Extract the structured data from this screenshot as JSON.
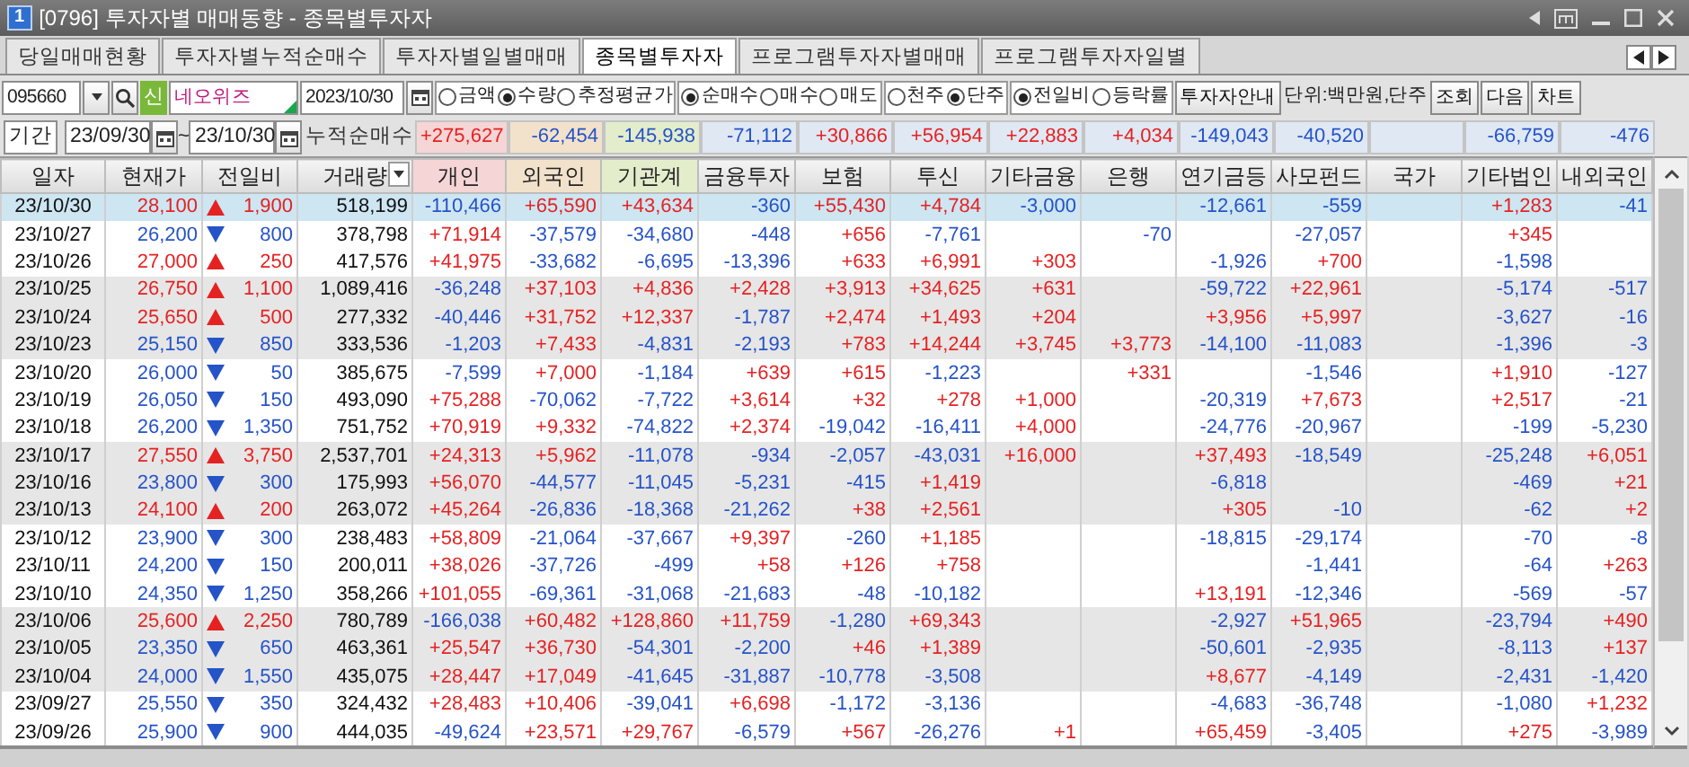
{
  "window": {
    "badge": "1",
    "title": "[0796] 투자자별 매매동향 - 종목별투자자"
  },
  "tabs": [
    {
      "label": "당일매매현황",
      "selected": false
    },
    {
      "label": "투자자별누적순매수",
      "selected": false
    },
    {
      "label": "투자자별일별매매",
      "selected": false
    },
    {
      "label": "종목별투자자",
      "selected": true
    },
    {
      "label": "프로그램투자자별매매",
      "selected": false
    },
    {
      "label": "프로그램투자자일별",
      "selected": false
    }
  ],
  "toolbar": {
    "stock_code": "095660",
    "market_badge": "신",
    "stock_name": "네오위즈",
    "date": "2023/10/30",
    "radio_groups": [
      [
        {
          "label": "금액",
          "selected": false
        },
        {
          "label": "수량",
          "selected": true
        },
        {
          "label": "추정평균가",
          "selected": false
        }
      ],
      [
        {
          "label": "순매수",
          "selected": true
        },
        {
          "label": "매수",
          "selected": false
        },
        {
          "label": "매도",
          "selected": false
        }
      ],
      [
        {
          "label": "천주",
          "selected": false
        },
        {
          "label": "단주",
          "selected": true
        }
      ],
      [
        {
          "label": "전일비",
          "selected": true
        },
        {
          "label": "등락률",
          "selected": false
        }
      ]
    ],
    "guide_button": "투자자안내",
    "unit": "단위:백만원,단주",
    "buttons": [
      "조회",
      "다음",
      "차트"
    ]
  },
  "period": {
    "label": "기간",
    "from": "23/09/30",
    "separator": "~",
    "to": "23/10/30",
    "summary_label": "누적순매수",
    "summary": {
      "column_5": "+275,627",
      "column_6": "-62,454",
      "column_7": "-145,938",
      "column_8": "-71,112",
      "column_9": "+30,866",
      "column_10": "+56,954",
      "column_11": "+22,883",
      "column_12": "+4,034",
      "column_13": "-149,043",
      "column_14": "-40,520",
      "column_16": "-66,759",
      "column_17": "-476"
    }
  },
  "table": {
    "columns": [
      {
        "label": "일자",
        "dropdown": false
      },
      {
        "label": "현재가",
        "dropdown": false
      },
      {
        "label": "전일비",
        "dropdown": false
      },
      {
        "label": "거래량",
        "dropdown": true
      },
      {
        "label": "개인",
        "dropdown": false,
        "color": "#f5d5d5"
      },
      {
        "label": "외국인",
        "dropdown": false,
        "color": "#f2e2cb"
      },
      {
        "label": "기관계",
        "dropdown": false,
        "color": "#e3edcc"
      },
      {
        "label": "금융투자",
        "dropdown": false
      },
      {
        "label": "보험",
        "dropdown": false
      },
      {
        "label": "투신",
        "dropdown": false
      },
      {
        "label": "기타금융",
        "dropdown": false
      },
      {
        "label": "은행",
        "dropdown": false
      },
      {
        "label": "연기금등",
        "dropdown": false
      },
      {
        "label": "사모펀드",
        "dropdown": false
      },
      {
        "label": "국가",
        "dropdown": false
      },
      {
        "label": "기타법인",
        "dropdown": false
      },
      {
        "label": "내외국인",
        "dropdown": false
      }
    ],
    "rows": [
      {
        "date": "23/10/30",
        "price": "28,100",
        "rising": true,
        "change": "1,900",
        "volume": "518,199",
        "selected": true,
        "shaded": false,
        "values": {
          "column_5": "-110,466",
          "column_6": "+65,590",
          "column_7": "+43,634",
          "column_8": "-360",
          "column_9": "+55,430",
          "column_10": "+4,784",
          "column_11": "-3,000",
          "column_13": "-12,661",
          "column_14": "-559",
          "column_16": "+1,283",
          "column_17": "-41"
        }
      },
      {
        "date": "23/10/27",
        "price": "26,200",
        "rising": false,
        "change": "800",
        "volume": "378,798",
        "selected": false,
        "shaded": false,
        "values": {
          "column_5": "+71,914",
          "column_6": "-37,579",
          "column_7": "-34,680",
          "column_8": "-448",
          "column_9": "+656",
          "column_10": "-7,761",
          "column_12": "-70",
          "column_14": "-27,057",
          "column_16": "+345"
        }
      },
      {
        "date": "23/10/26",
        "price": "27,000",
        "rising": true,
        "change": "250",
        "volume": "417,576",
        "selected": false,
        "shaded": false,
        "values": {
          "column_5": "+41,975",
          "column_6": "-33,682",
          "column_7": "-6,695",
          "column_8": "-13,396",
          "column_9": "+633",
          "column_10": "+6,991",
          "column_11": "+303",
          "column_13": "-1,926",
          "column_14": "+700",
          "column_16": "-1,598"
        }
      },
      {
        "date": "23/10/25",
        "price": "26,750",
        "rising": true,
        "change": "1,100",
        "volume": "1,089,416",
        "selected": false,
        "shaded": true,
        "values": {
          "column_5": "-36,248",
          "column_6": "+37,103",
          "column_7": "+4,836",
          "column_8": "+2,428",
          "column_9": "+3,913",
          "column_10": "+34,625",
          "column_11": "+631",
          "column_13": "-59,722",
          "column_14": "+22,961",
          "column_16": "-5,174",
          "column_17": "-517"
        }
      },
      {
        "date": "23/10/24",
        "price": "25,650",
        "rising": true,
        "change": "500",
        "volume": "277,332",
        "selected": false,
        "shaded": true,
        "values": {
          "column_5": "-40,446",
          "column_6": "+31,752",
          "column_7": "+12,337",
          "column_8": "-1,787",
          "column_9": "+2,474",
          "column_10": "+1,493",
          "column_11": "+204",
          "column_13": "+3,956",
          "column_14": "+5,997",
          "column_16": "-3,627",
          "column_17": "-16"
        }
      },
      {
        "date": "23/10/23",
        "price": "25,150",
        "rising": false,
        "change": "850",
        "volume": "333,536",
        "selected": false,
        "shaded": true,
        "values": {
          "column_5": "-1,203",
          "column_6": "+7,433",
          "column_7": "-4,831",
          "column_8": "-2,193",
          "column_9": "+783",
          "column_10": "+14,244",
          "column_11": "+3,745",
          "column_12": "+3,773",
          "column_13": "-14,100",
          "column_14": "-11,083",
          "column_16": "-1,396",
          "column_17": "-3"
        }
      },
      {
        "date": "23/10/20",
        "price": "26,000",
        "rising": false,
        "change": "50",
        "volume": "385,675",
        "selected": false,
        "shaded": false,
        "values": {
          "column_5": "-7,599",
          "column_6": "+7,000",
          "column_7": "-1,184",
          "column_8": "+639",
          "column_9": "+615",
          "column_10": "-1,223",
          "column_12": "+331",
          "column_14": "-1,546",
          "column_16": "+1,910",
          "column_17": "-127"
        }
      },
      {
        "date": "23/10/19",
        "price": "26,050",
        "rising": false,
        "change": "150",
        "volume": "493,090",
        "selected": false,
        "shaded": false,
        "values": {
          "column_5": "+75,288",
          "column_6": "-70,062",
          "column_7": "-7,722",
          "column_8": "+3,614",
          "column_9": "+32",
          "column_10": "+278",
          "column_11": "+1,000",
          "column_13": "-20,319",
          "column_14": "+7,673",
          "column_16": "+2,517",
          "column_17": "-21"
        }
      },
      {
        "date": "23/10/18",
        "price": "26,200",
        "rising": false,
        "change": "1,350",
        "volume": "751,752",
        "selected": false,
        "shaded": false,
        "values": {
          "column_5": "+70,919",
          "column_6": "+9,332",
          "column_7": "-74,822",
          "column_8": "+2,374",
          "column_9": "-19,042",
          "column_10": "-16,411",
          "column_11": "+4,000",
          "column_13": "-24,776",
          "column_14": "-20,967",
          "column_16": "-199",
          "column_17": "-5,230"
        }
      },
      {
        "date": "23/10/17",
        "price": "27,550",
        "rising": true,
        "change": "3,750",
        "volume": "2,537,701",
        "selected": false,
        "shaded": true,
        "values": {
          "column_5": "+24,313",
          "column_6": "+5,962",
          "column_7": "-11,078",
          "column_8": "-934",
          "column_9": "-2,057",
          "column_10": "-43,031",
          "column_11": "+16,000",
          "column_13": "+37,493",
          "column_14": "-18,549",
          "column_16": "-25,248",
          "column_17": "+6,051"
        }
      },
      {
        "date": "23/10/16",
        "price": "23,800",
        "rising": false,
        "change": "300",
        "volume": "175,993",
        "selected": false,
        "shaded": true,
        "values": {
          "column_5": "+56,070",
          "column_6": "-44,577",
          "column_7": "-11,045",
          "column_8": "-5,231",
          "column_9": "-415",
          "column_10": "+1,419",
          "column_13": "-6,818",
          "column_16": "-469",
          "column_17": "+21"
        }
      },
      {
        "date": "23/10/13",
        "price": "24,100",
        "rising": true,
        "change": "200",
        "volume": "263,072",
        "selected": false,
        "shaded": true,
        "values": {
          "column_5": "+45,264",
          "column_6": "-26,836",
          "column_7": "-18,368",
          "column_8": "-21,262",
          "column_9": "+38",
          "column_10": "+2,561",
          "column_13": "+305",
          "column_14": "-10",
          "column_16": "-62",
          "column_17": "+2"
        }
      },
      {
        "date": "23/10/12",
        "price": "23,900",
        "rising": false,
        "change": "300",
        "volume": "238,483",
        "selected": false,
        "shaded": false,
        "values": {
          "column_5": "+58,809",
          "column_6": "-21,064",
          "column_7": "-37,667",
          "column_8": "+9,397",
          "column_9": "-260",
          "column_10": "+1,185",
          "column_13": "-18,815",
          "column_14": "-29,174",
          "column_16": "-70",
          "column_17": "-8"
        }
      },
      {
        "date": "23/10/11",
        "price": "24,200",
        "rising": false,
        "change": "150",
        "volume": "200,011",
        "selected": false,
        "shaded": false,
        "values": {
          "column_5": "+38,026",
          "column_6": "-37,726",
          "column_7": "-499",
          "column_8": "+58",
          "column_9": "+126",
          "column_10": "+758",
          "column_14": "-1,441",
          "column_16": "-64",
          "column_17": "+263"
        }
      },
      {
        "date": "23/10/10",
        "price": "24,350",
        "rising": false,
        "change": "1,250",
        "volume": "358,266",
        "selected": false,
        "shaded": false,
        "values": {
          "column_5": "+101,055",
          "column_6": "-69,361",
          "column_7": "-31,068",
          "column_8": "-21,683",
          "column_9": "-48",
          "column_10": "-10,182",
          "column_13": "+13,191",
          "column_14": "-12,346",
          "column_16": "-569",
          "column_17": "-57"
        }
      },
      {
        "date": "23/10/06",
        "price": "25,600",
        "rising": true,
        "change": "2,250",
        "volume": "780,789",
        "selected": false,
        "shaded": true,
        "values": {
          "column_5": "-166,038",
          "column_6": "+60,482",
          "column_7": "+128,860",
          "column_8": "+11,759",
          "column_9": "-1,280",
          "column_10": "+69,343",
          "column_13": "-2,927",
          "column_14": "+51,965",
          "column_16": "-23,794",
          "column_17": "+490"
        }
      },
      {
        "date": "23/10/05",
        "price": "23,350",
        "rising": false,
        "change": "650",
        "volume": "463,361",
        "selected": false,
        "shaded": true,
        "values": {
          "column_5": "+25,547",
          "column_6": "+36,730",
          "column_7": "-54,301",
          "column_8": "-2,200",
          "column_9": "+46",
          "column_10": "+1,389",
          "column_13": "-50,601",
          "column_14": "-2,935",
          "column_16": "-8,113",
          "column_17": "+137"
        }
      },
      {
        "date": "23/10/04",
        "price": "24,000",
        "rising": false,
        "change": "1,550",
        "volume": "435,075",
        "selected": false,
        "shaded": true,
        "values": {
          "column_5": "+28,447",
          "column_6": "+17,049",
          "column_7": "-41,645",
          "column_8": "-31,887",
          "column_9": "-10,778",
          "column_10": "-3,508",
          "column_13": "+8,677",
          "column_14": "-4,149",
          "column_16": "-2,431",
          "column_17": "-1,420"
        }
      },
      {
        "date": "23/09/27",
        "price": "25,550",
        "rising": false,
        "change": "350",
        "volume": "324,432",
        "selected": false,
        "shaded": false,
        "values": {
          "column_5": "+28,483",
          "column_6": "+10,406",
          "column_7": "-39,041",
          "column_8": "+6,698",
          "column_9": "-1,172",
          "column_10": "-3,136",
          "column_13": "-4,683",
          "column_14": "-36,748",
          "column_16": "-1,080",
          "column_17": "+1,232"
        }
      },
      {
        "date": "23/09/26",
        "price": "25,900",
        "rising": false,
        "change": "900",
        "volume": "444,035",
        "selected": false,
        "shaded": false,
        "values": {
          "column_5": "-49,624",
          "column_6": "+23,571",
          "column_7": "+29,767",
          "column_8": "-6,579",
          "column_9": "+567",
          "column_10": "-26,276",
          "column_11": "+1",
          "column_13": "+65,459",
          "column_14": "-3,405",
          "column_16": "+275",
          "column_17": "-3,989"
        }
      }
    ]
  }
}
